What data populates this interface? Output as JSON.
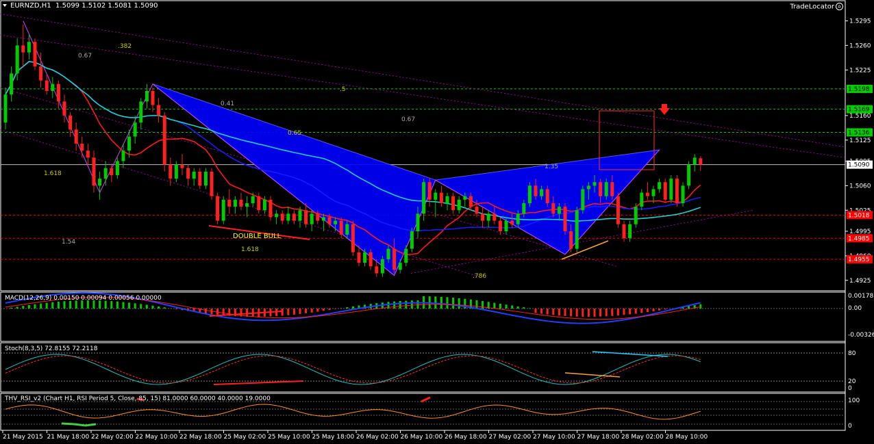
{
  "header": {
    "symbol": "EURNZD,H1",
    "ohlc": "1.5099 1.5102 1.5081 1.5090",
    "tradelocator": "TradeLocator"
  },
  "colors": {
    "background": "#000000",
    "bull_candle": "#00cc00",
    "bear_candle": "#ff2020",
    "pattern_fill": "#0000ff",
    "ma_red": "#ff1a1a",
    "ma_blue": "#1a1aff",
    "ma_cyan": "#20d0d0",
    "level_green": "#00cc00",
    "level_red": "#ff0000",
    "trend_magenta": "#cc00cc"
  },
  "price_axis": {
    "ticks": [
      "1.5295",
      "1.5260",
      "1.5225",
      "1.5160",
      "1.5125",
      "1.5095",
      "1.5060",
      "1.5025",
      "1.4995",
      "1.4960",
      "1.4925"
    ],
    "hlines": [
      {
        "label": "1.5198",
        "kind": "green"
      },
      {
        "label": "1.5169",
        "kind": "green"
      },
      {
        "label": "1.5136",
        "kind": "green"
      },
      {
        "label": "1.5090",
        "kind": "current"
      },
      {
        "label": "1.5018",
        "kind": "red"
      },
      {
        "label": "1.4985",
        "kind": "red"
      },
      {
        "label": "1.4955",
        "kind": "red"
      }
    ]
  },
  "fib_labels": [
    ".382",
    "0.67",
    ".5",
    "0.41",
    "0.67",
    "0.65",
    "1.618",
    "1.35",
    "1.54",
    "1.618",
    ".786"
  ],
  "annotation": "DOUBLE BULL",
  "indicators": {
    "macd": {
      "title": "MACD(12,26,9) 0.00150 0.00094 0.00056 0.00000",
      "ticks": [
        "0.00178",
        "0.00",
        "-0.00326"
      ]
    },
    "stoch": {
      "title": "Stoch(8,3,5) 72.8155 72.2118",
      "ticks": [
        "80",
        "20",
        "0"
      ]
    },
    "rsi": {
      "title": "THV_RSI_v2   (Chart H1,  RSI Period 5,  Close,  85,  15)  81.0000 60.0000 40.0000 19.0000",
      "ticks": [
        "100",
        "0"
      ]
    }
  },
  "time_axis": [
    "21 May 2015",
    "21 May 18:00",
    "22 May 02:00",
    "22 May 10:00",
    "22 May 18:00",
    "25 May 02:00",
    "25 May 10:00",
    "25 May 18:00",
    "26 May 02:00",
    "26 May 10:00",
    "26 May 18:00",
    "27 May 02:00",
    "27 May 10:00",
    "27 May 18:00",
    "28 May 02:00",
    "28 May 10:00"
  ],
  "chart_data": {
    "type": "candlestick",
    "title": "EURNZD,H1",
    "timeframe": "H1",
    "ylim": [
      1.4915,
      1.5315
    ],
    "candles": [
      {
        "o": 1.515,
        "h": 1.52,
        "l": 1.514,
        "c": 1.519
      },
      {
        "o": 1.519,
        "h": 1.523,
        "l": 1.518,
        "c": 1.522
      },
      {
        "o": 1.522,
        "h": 1.527,
        "l": 1.521,
        "c": 1.526
      },
      {
        "o": 1.526,
        "h": 1.529,
        "l": 1.523,
        "c": 1.525
      },
      {
        "o": 1.525,
        "h": 1.5275,
        "l": 1.524,
        "c": 1.5265
      },
      {
        "o": 1.5265,
        "h": 1.527,
        "l": 1.5225,
        "c": 1.523
      },
      {
        "o": 1.523,
        "h": 1.525,
        "l": 1.52,
        "c": 1.521
      },
      {
        "o": 1.521,
        "h": 1.522,
        "l": 1.519,
        "c": 1.5195
      },
      {
        "o": 1.5195,
        "h": 1.5215,
        "l": 1.5185,
        "c": 1.5205
      },
      {
        "o": 1.5205,
        "h": 1.521,
        "l": 1.517,
        "c": 1.518
      },
      {
        "o": 1.518,
        "h": 1.519,
        "l": 1.515,
        "c": 1.516
      },
      {
        "o": 1.516,
        "h": 1.5165,
        "l": 1.513,
        "c": 1.514
      },
      {
        "o": 1.514,
        "h": 1.515,
        "l": 1.511,
        "c": 1.512
      },
      {
        "o": 1.512,
        "h": 1.513,
        "l": 1.51,
        "c": 1.511
      },
      {
        "o": 1.511,
        "h": 1.512,
        "l": 1.509,
        "c": 1.51
      },
      {
        "o": 1.51,
        "h": 1.511,
        "l": 1.505,
        "c": 1.506
      },
      {
        "o": 1.506,
        "h": 1.508,
        "l": 1.504,
        "c": 1.507
      },
      {
        "o": 1.507,
        "h": 1.5095,
        "l": 1.506,
        "c": 1.5085
      },
      {
        "o": 1.5085,
        "h": 1.509,
        "l": 1.5065,
        "c": 1.5075
      },
      {
        "o": 1.5075,
        "h": 1.51,
        "l": 1.507,
        "c": 1.5095
      },
      {
        "o": 1.5095,
        "h": 1.512,
        "l": 1.5085,
        "c": 1.511
      },
      {
        "o": 1.511,
        "h": 1.514,
        "l": 1.51,
        "c": 1.513
      },
      {
        "o": 1.513,
        "h": 1.516,
        "l": 1.512,
        "c": 1.515
      },
      {
        "o": 1.515,
        "h": 1.5185,
        "l": 1.514,
        "c": 1.518
      },
      {
        "o": 1.518,
        "h": 1.5205,
        "l": 1.517,
        "c": 1.5195
      },
      {
        "o": 1.5195,
        "h": 1.52,
        "l": 1.5165,
        "c": 1.5175
      },
      {
        "o": 1.5175,
        "h": 1.5185,
        "l": 1.515,
        "c": 1.516
      },
      {
        "o": 1.516,
        "h": 1.5165,
        "l": 1.508,
        "c": 1.509
      },
      {
        "o": 1.509,
        "h": 1.51,
        "l": 1.506,
        "c": 1.507
      },
      {
        "o": 1.507,
        "h": 1.5095,
        "l": 1.5065,
        "c": 1.509
      },
      {
        "o": 1.509,
        "h": 1.5105,
        "l": 1.5075,
        "c": 1.5085
      },
      {
        "o": 1.5085,
        "h": 1.509,
        "l": 1.506,
        "c": 1.507
      },
      {
        "o": 1.507,
        "h": 1.5085,
        "l": 1.506,
        "c": 1.508
      },
      {
        "o": 1.508,
        "h": 1.5085,
        "l": 1.5055,
        "c": 1.506
      },
      {
        "o": 1.506,
        "h": 1.5085,
        "l": 1.5055,
        "c": 1.508
      },
      {
        "o": 1.508,
        "h": 1.5085,
        "l": 1.504,
        "c": 1.5045
      },
      {
        "o": 1.5045,
        "h": 1.505,
        "l": 1.5005,
        "c": 1.501
      },
      {
        "o": 1.501,
        "h": 1.5045,
        "l": 1.5005,
        "c": 1.504
      },
      {
        "o": 1.504,
        "h": 1.5055,
        "l": 1.502,
        "c": 1.503
      },
      {
        "o": 1.503,
        "h": 1.5045,
        "l": 1.502,
        "c": 1.504
      },
      {
        "o": 1.504,
        "h": 1.505,
        "l": 1.5025,
        "c": 1.503
      },
      {
        "o": 1.503,
        "h": 1.5045,
        "l": 1.5015,
        "c": 1.5035
      },
      {
        "o": 1.5035,
        "h": 1.505,
        "l": 1.503,
        "c": 1.5045
      },
      {
        "o": 1.5045,
        "h": 1.505,
        "l": 1.502,
        "c": 1.5025
      },
      {
        "o": 1.5025,
        "h": 1.5045,
        "l": 1.502,
        "c": 1.504
      },
      {
        "o": 1.504,
        "h": 1.5045,
        "l": 1.501,
        "c": 1.5015
      },
      {
        "o": 1.5015,
        "h": 1.5025,
        "l": 1.5005,
        "c": 1.502
      },
      {
        "o": 1.502,
        "h": 1.5025,
        "l": 1.5005,
        "c": 1.501
      },
      {
        "o": 1.501,
        "h": 1.503,
        "l": 1.5005,
        "c": 1.502
      },
      {
        "o": 1.502,
        "h": 1.5025,
        "l": 1.5005,
        "c": 1.501
      },
      {
        "o": 1.501,
        "h": 1.503,
        "l": 1.5,
        "c": 1.5025
      },
      {
        "o": 1.5025,
        "h": 1.5035,
        "l": 1.5,
        "c": 1.5005
      },
      {
        "o": 1.5005,
        "h": 1.5025,
        "l": 1.4995,
        "c": 1.502
      },
      {
        "o": 1.502,
        "h": 1.5025,
        "l": 1.5005,
        "c": 1.501
      },
      {
        "o": 1.501,
        "h": 1.502,
        "l": 1.4995,
        "c": 1.5015
      },
      {
        "o": 1.5015,
        "h": 1.502,
        "l": 1.5,
        "c": 1.5005
      },
      {
        "o": 1.5005,
        "h": 1.5015,
        "l": 1.4995,
        "c": 1.501
      },
      {
        "o": 1.501,
        "h": 1.5015,
        "l": 1.4985,
        "c": 1.499
      },
      {
        "o": 1.499,
        "h": 1.501,
        "l": 1.4985,
        "c": 1.5005
      },
      {
        "o": 1.5005,
        "h": 1.501,
        "l": 1.496,
        "c": 1.4965
      },
      {
        "o": 1.4965,
        "h": 1.4975,
        "l": 1.4945,
        "c": 1.495
      },
      {
        "o": 1.495,
        "h": 1.497,
        "l": 1.4945,
        "c": 1.4965
      },
      {
        "o": 1.4965,
        "h": 1.497,
        "l": 1.494,
        "c": 1.4945
      },
      {
        "o": 1.4945,
        "h": 1.4955,
        "l": 1.493,
        "c": 1.4935
      },
      {
        "o": 1.4935,
        "h": 1.496,
        "l": 1.493,
        "c": 1.4955
      },
      {
        "o": 1.4955,
        "h": 1.4975,
        "l": 1.495,
        "c": 1.497
      },
      {
        "o": 1.497,
        "h": 1.4985,
        "l": 1.4935,
        "c": 1.494
      },
      {
        "o": 1.494,
        "h": 1.4955,
        "l": 1.4935,
        "c": 1.495
      },
      {
        "o": 1.495,
        "h": 1.4975,
        "l": 1.4945,
        "c": 1.497
      },
      {
        "o": 1.497,
        "h": 1.5,
        "l": 1.4965,
        "c": 1.4995
      },
      {
        "o": 1.4995,
        "h": 1.503,
        "l": 1.4985,
        "c": 1.502
      },
      {
        "o": 1.502,
        "h": 1.507,
        "l": 1.501,
        "c": 1.5065
      },
      {
        "o": 1.5065,
        "h": 1.507,
        "l": 1.503,
        "c": 1.504
      },
      {
        "o": 1.504,
        "h": 1.5055,
        "l": 1.5015,
        "c": 1.505
      },
      {
        "o": 1.505,
        "h": 1.506,
        "l": 1.503,
        "c": 1.5035
      },
      {
        "o": 1.5035,
        "h": 1.505,
        "l": 1.5025,
        "c": 1.5045
      },
      {
        "o": 1.5045,
        "h": 1.505,
        "l": 1.502,
        "c": 1.5025
      },
      {
        "o": 1.5025,
        "h": 1.5045,
        "l": 1.502,
        "c": 1.504
      },
      {
        "o": 1.504,
        "h": 1.505,
        "l": 1.503,
        "c": 1.5045
      },
      {
        "o": 1.5045,
        "h": 1.505,
        "l": 1.5025,
        "c": 1.503
      },
      {
        "o": 1.503,
        "h": 1.504,
        "l": 1.5015,
        "c": 1.502
      },
      {
        "o": 1.502,
        "h": 1.503,
        "l": 1.5,
        "c": 1.501
      },
      {
        "o": 1.501,
        "h": 1.5025,
        "l": 1.5,
        "c": 1.502
      },
      {
        "o": 1.502,
        "h": 1.503,
        "l": 1.5005,
        "c": 1.501
      },
      {
        "o": 1.501,
        "h": 1.5015,
        "l": 1.499,
        "c": 1.4995
      },
      {
        "o": 1.4995,
        "h": 1.5015,
        "l": 1.499,
        "c": 1.501
      },
      {
        "o": 1.501,
        "h": 1.502,
        "l": 1.5,
        "c": 1.5005
      },
      {
        "o": 1.5005,
        "h": 1.5025,
        "l": 1.5,
        "c": 1.502
      },
      {
        "o": 1.502,
        "h": 1.504,
        "l": 1.5015,
        "c": 1.5035
      },
      {
        "o": 1.5035,
        "h": 1.5065,
        "l": 1.503,
        "c": 1.506
      },
      {
        "o": 1.506,
        "h": 1.507,
        "l": 1.504,
        "c": 1.5045
      },
      {
        "o": 1.5045,
        "h": 1.506,
        "l": 1.504,
        "c": 1.5055
      },
      {
        "o": 1.5055,
        "h": 1.506,
        "l": 1.503,
        "c": 1.5035
      },
      {
        "o": 1.5035,
        "h": 1.5045,
        "l": 1.5015,
        "c": 1.502
      },
      {
        "o": 1.502,
        "h": 1.5035,
        "l": 1.501,
        "c": 1.503
      },
      {
        "o": 1.503,
        "h": 1.5035,
        "l": 1.499,
        "c": 1.4995
      },
      {
        "o": 1.4995,
        "h": 1.5005,
        "l": 1.4965,
        "c": 1.497
      },
      {
        "o": 1.497,
        "h": 1.503,
        "l": 1.4965,
        "c": 1.5025
      },
      {
        "o": 1.5025,
        "h": 1.506,
        "l": 1.502,
        "c": 1.5055
      },
      {
        "o": 1.5055,
        "h": 1.5065,
        "l": 1.504,
        "c": 1.506
      },
      {
        "o": 1.506,
        "h": 1.5075,
        "l": 1.505,
        "c": 1.5065
      },
      {
        "o": 1.5065,
        "h": 1.507,
        "l": 1.5035,
        "c": 1.5045
      },
      {
        "o": 1.5045,
        "h": 1.507,
        "l": 1.504,
        "c": 1.5065
      },
      {
        "o": 1.5065,
        "h": 1.5075,
        "l": 1.504,
        "c": 1.5045
      },
      {
        "o": 1.5045,
        "h": 1.505,
        "l": 1.5,
        "c": 1.5005
      },
      {
        "o": 1.5005,
        "h": 1.501,
        "l": 1.498,
        "c": 1.4985
      },
      {
        "o": 1.4985,
        "h": 1.501,
        "l": 1.498,
        "c": 1.5005
      },
      {
        "o": 1.5005,
        "h": 1.5035,
        "l": 1.5,
        "c": 1.503
      },
      {
        "o": 1.503,
        "h": 1.5055,
        "l": 1.5025,
        "c": 1.505
      },
      {
        "o": 1.505,
        "h": 1.5065,
        "l": 1.504,
        "c": 1.5045
      },
      {
        "o": 1.5045,
        "h": 1.506,
        "l": 1.5035,
        "c": 1.5055
      },
      {
        "o": 1.5055,
        "h": 1.507,
        "l": 1.505,
        "c": 1.5065
      },
      {
        "o": 1.5065,
        "h": 1.507,
        "l": 1.5035,
        "c": 1.504
      },
      {
        "o": 1.504,
        "h": 1.5075,
        "l": 1.5035,
        "c": 1.507
      },
      {
        "o": 1.507,
        "h": 1.5075,
        "l": 1.503,
        "c": 1.5035
      },
      {
        "o": 1.5035,
        "h": 1.5065,
        "l": 1.503,
        "c": 1.506
      },
      {
        "o": 1.506,
        "h": 1.5095,
        "l": 1.5055,
        "c": 1.509
      },
      {
        "o": 1.509,
        "h": 1.5105,
        "l": 1.508,
        "c": 1.51
      },
      {
        "o": 1.5099,
        "h": 1.5102,
        "l": 1.5081,
        "c": 1.509
      }
    ]
  }
}
